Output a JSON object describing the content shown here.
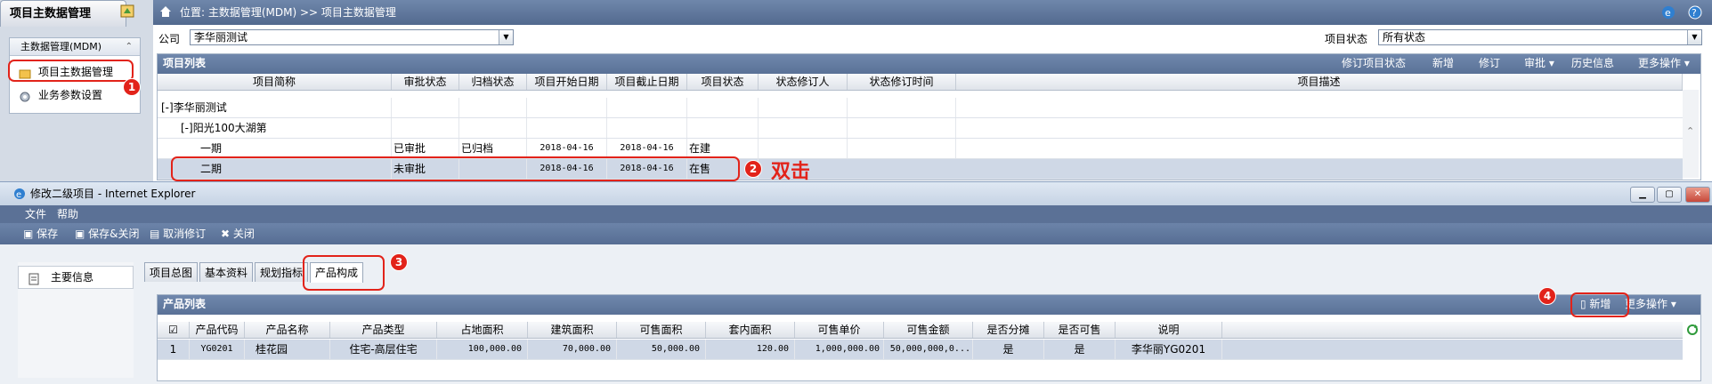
{
  "nav": {
    "title": "项目主数据管理",
    "group_title": "主数据管理(MDM)",
    "items": [
      {
        "label": "项目主数据管理"
      },
      {
        "label": "业务参数设置"
      }
    ]
  },
  "breadcrumb": "位置: 主数据管理(MDM) >> 项目主数据管理",
  "filters": {
    "company_label": "公司",
    "company_value": "李华丽测试",
    "status_label": "项目状态",
    "status_value": "所有状态"
  },
  "project_list": {
    "title": "项目列表",
    "actions": [
      "修订项目状态",
      "新增",
      "修订",
      "审批 ▾",
      "历史信息",
      "更多操作 ▾"
    ],
    "columns": [
      "项目简称",
      "审批状态",
      "归档状态",
      "项目开始日期",
      "项目截止日期",
      "项目状态",
      "状态修订人",
      "状态修订时间",
      "项目描述"
    ],
    "rows": [
      {
        "name": "[-]李华丽测试",
        "approval": "",
        "archive": "",
        "start": "",
        "end": "",
        "status": "",
        "reviser": "",
        "revise_time": "",
        "desc": ""
      },
      {
        "name": "[-]阳光100大湖第",
        "approval": "",
        "archive": "",
        "start": "",
        "end": "",
        "status": "",
        "reviser": "",
        "revise_time": "",
        "desc": ""
      },
      {
        "name": "一期",
        "approval": "已审批",
        "archive": "已归档",
        "start": "2018-04-16",
        "end": "2018-04-16",
        "status": "在建",
        "reviser": "",
        "revise_time": "",
        "desc": ""
      },
      {
        "name": "二期",
        "approval": "未审批",
        "archive": "",
        "start": "2018-04-16",
        "end": "2018-04-16",
        "status": "在售",
        "reviser": "",
        "revise_time": "",
        "desc": ""
      }
    ]
  },
  "annotations": {
    "b1": "1",
    "b2": "2",
    "b3": "3",
    "b4": "4",
    "dblclick": "双击"
  },
  "ie": {
    "title": "修改二级项目 - Internet Explorer",
    "menu": [
      "文件",
      "帮助"
    ],
    "toolbar": [
      "保存",
      "保存&关闭",
      "取消修订",
      "关闭"
    ],
    "side_item": "主要信息",
    "tabs": [
      "项目总图",
      "基本资料",
      "规划指标",
      "产品构成"
    ],
    "product_list": {
      "title": "产品列表",
      "add_label": "新增",
      "more_label": "更多操作 ▾",
      "columns": [
        "产品代码",
        "产品名称",
        "产品类型",
        "占地面积",
        "建筑面积",
        "可售面积",
        "套内面积",
        "可售单价",
        "可售金额",
        "是否分摊",
        "是否可售",
        "说明"
      ],
      "rows": [
        {
          "idx": "1",
          "code": "YG0201",
          "name": "桂花园",
          "type": "住宅-高层住宅",
          "land": "100,000.00",
          "build": "70,000.00",
          "sale": "50,000.00",
          "inner": "120.00",
          "price": "1,000,000.00",
          "amount": "50,000,000,0...",
          "share": "是",
          "sellable": "是",
          "note": "李华丽YG0201"
        }
      ]
    }
  },
  "colors": {
    "accent": "#5a7197",
    "annotation": "#e2231a",
    "selected_row": "#cfd8e6"
  }
}
